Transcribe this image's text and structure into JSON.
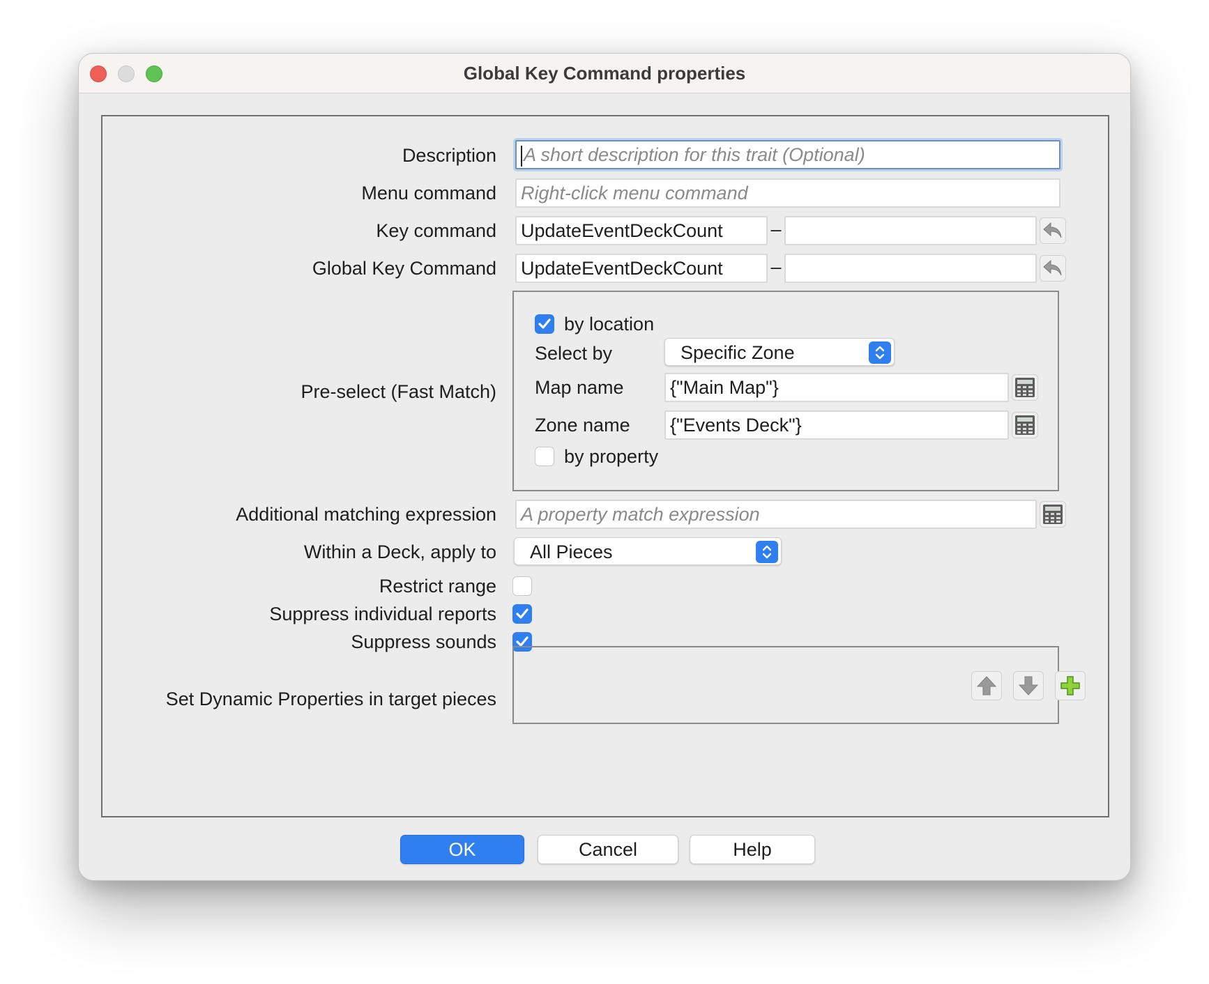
{
  "window": {
    "title": "Global Key Command properties"
  },
  "form": {
    "description": {
      "label": "Description",
      "placeholder": "A short description for this trait (Optional)"
    },
    "menu_command": {
      "label": "Menu command",
      "placeholder": "Right-click menu command"
    },
    "key_command": {
      "label": "Key command",
      "value": "UpdateEventDeckCount",
      "separator": "–",
      "secondary_value": ""
    },
    "global_key_command": {
      "label": "Global Key Command",
      "value": "UpdateEventDeckCount",
      "separator": "–",
      "secondary_value": ""
    },
    "preselect": {
      "label": "Pre-select (Fast Match)",
      "by_location": {
        "label": "by location",
        "checked": true
      },
      "select_by": {
        "label": "Select by",
        "value": "Specific Zone"
      },
      "map_name": {
        "label": "Map name",
        "value": "{\"Main Map\"}"
      },
      "zone_name": {
        "label": "Zone name",
        "value": "{\"Events Deck\"}"
      },
      "by_property": {
        "label": "by property",
        "checked": false
      }
    },
    "additional_matching": {
      "label": "Additional matching expression",
      "placeholder": "A property match expression"
    },
    "within_deck": {
      "label": "Within a Deck, apply to",
      "value": "All Pieces"
    },
    "restrict_range": {
      "label": "Restrict range",
      "checked": false
    },
    "suppress_reports": {
      "label": "Suppress individual reports",
      "checked": true
    },
    "suppress_sounds": {
      "label": "Suppress sounds",
      "checked": true
    },
    "dynamic_properties": {
      "label": "Set Dynamic Properties in target pieces"
    }
  },
  "buttons": {
    "ok": "OK",
    "cancel": "Cancel",
    "help": "Help"
  },
  "colors": {
    "accent": "#2f7ff0",
    "window_bg": "#ececec",
    "close": "#ee5f57",
    "maximize": "#5fc453"
  }
}
